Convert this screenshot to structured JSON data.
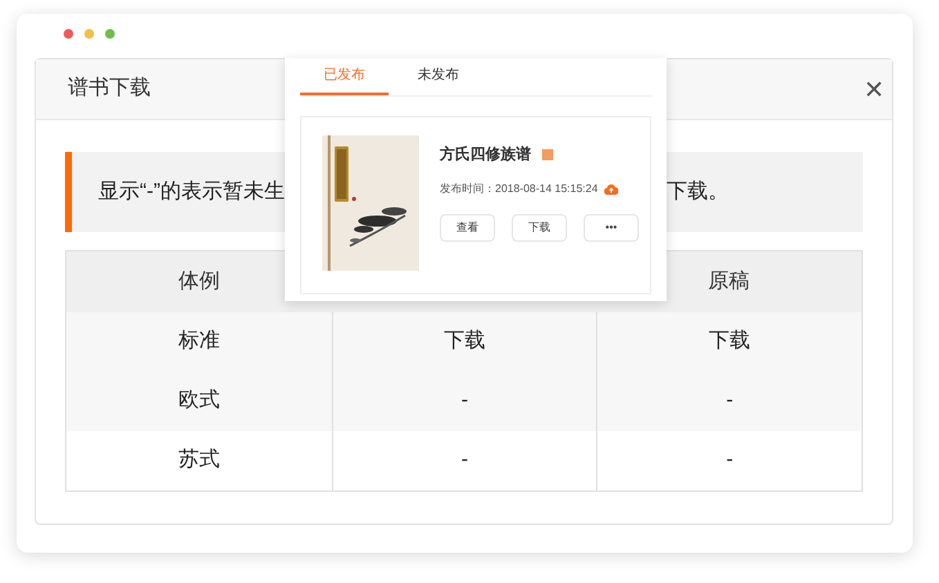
{
  "dialog": {
    "title": "谱书下载",
    "close": "✕"
  },
  "notice": {
    "text_start": "显示“-”的表示暂未生",
    "text_end": "下载。"
  },
  "table": {
    "columns": [
      "体例",
      null,
      "原稿"
    ],
    "rows": [
      {
        "cells": [
          "标准",
          "下载",
          "下载"
        ]
      },
      {
        "cells": [
          "欧式",
          "-",
          "-"
        ]
      },
      {
        "cells": [
          "苏式",
          "-",
          "-"
        ]
      }
    ]
  },
  "popover": {
    "tabs": [
      {
        "label": "已发布",
        "selected": true
      },
      {
        "label": "未发布",
        "selected": false
      }
    ],
    "book": {
      "kind": "picture",
      "title": "方氏四修族谱",
      "published": "发布时间：2018-08-14 15:15:24",
      "actions": [
        "查看",
        "下载",
        "•••"
      ]
    }
  }
}
